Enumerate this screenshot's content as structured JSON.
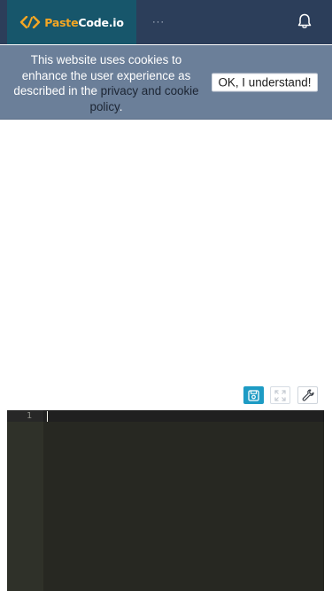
{
  "header": {
    "logo": {
      "part1": "Paste",
      "part2": "Code.io"
    },
    "more_label": "···",
    "icons": {
      "logo": "code-brackets-icon",
      "bell": "bell-icon"
    },
    "colors": {
      "bar": "#2c3e5a",
      "logo_bg": "#17566b",
      "brand_orange": "#f5a623"
    }
  },
  "cookie_banner": {
    "message_before": "This website uses cookies to enhance the user experience as described in the ",
    "link_text": "privacy and cookie policy",
    "message_after": ".",
    "button_label": "OK, I understand!",
    "colors": {
      "background": "#6b7f99"
    }
  },
  "toolbar": {
    "icons": {
      "save": "save-icon",
      "fullscreen": "fullscreen-icon",
      "settings": "wrench-icon"
    },
    "colors": {
      "save_bg": "#1d9bc4"
    }
  },
  "editor": {
    "line_numbers": [
      "1"
    ],
    "content": "",
    "colors": {
      "background": "#272822",
      "gutter": "#2f3129"
    }
  }
}
